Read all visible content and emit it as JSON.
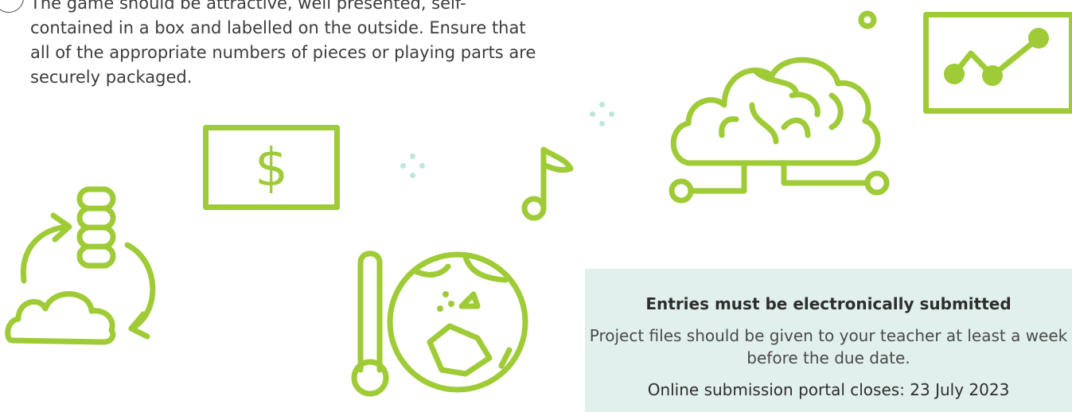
{
  "requirement": {
    "text": "The game should be attractive, well presented, self-contained in a box and labelled on the outside. Ensure that all of the appropriate numbers of pieces or playing parts are securely packaged."
  },
  "icons": {
    "money": {
      "name": "dollar-bill-icon",
      "symbol": "$"
    },
    "music": {
      "name": "music-note-icon"
    },
    "brain": {
      "name": "brain-cloud-icon"
    },
    "chart": {
      "name": "line-chart-icon"
    },
    "data": {
      "name": "database-cloud-sync-icon"
    },
    "climate": {
      "name": "globe-thermometer-icon"
    }
  },
  "colors": {
    "icon": "#9ecb36",
    "box": "#e1f0ec",
    "sparkle": "#bde6dc"
  },
  "info_box": {
    "title": "Entries must be electronically submitted",
    "body": "Project files should be given to your teacher at least a week before the due date.",
    "deadline": "Online submission portal closes: 23 July 2023"
  }
}
